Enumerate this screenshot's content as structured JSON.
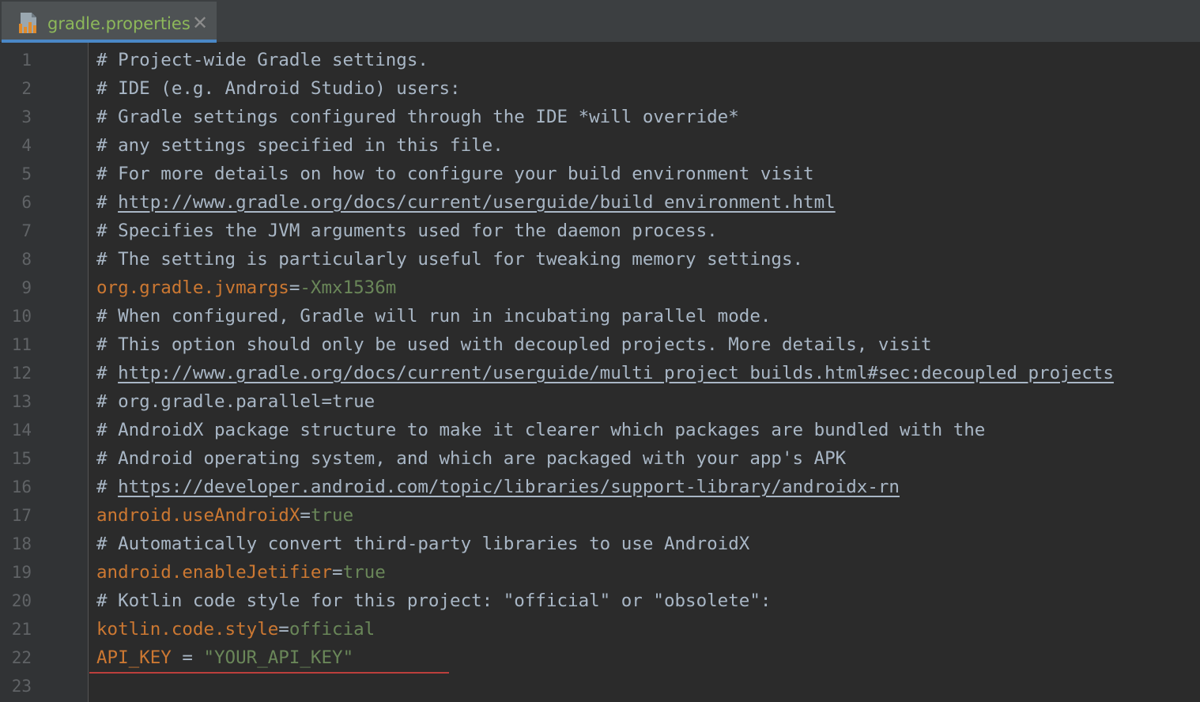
{
  "tab": {
    "label": "gradle.properties",
    "close_glyph": "✕",
    "icon": "gradle-properties-file-icon"
  },
  "colors": {
    "comment": "#a9b7c6",
    "key": "#cc7832",
    "value": "#6a8759",
    "error": "#bc3f3c",
    "tab_accent": "#4a88c7"
  },
  "lines": [
    {
      "n": "1",
      "parts": [
        {
          "t": "cm",
          "s": "# Project-wide Gradle settings."
        }
      ]
    },
    {
      "n": "2",
      "parts": [
        {
          "t": "cm",
          "s": "# IDE (e.g. Android Studio) users:"
        }
      ]
    },
    {
      "n": "3",
      "parts": [
        {
          "t": "cm",
          "s": "# Gradle settings configured through the IDE *will override*"
        }
      ]
    },
    {
      "n": "4",
      "parts": [
        {
          "t": "cm",
          "s": "# any settings specified in this file."
        }
      ]
    },
    {
      "n": "5",
      "parts": [
        {
          "t": "cm",
          "s": "# For more details on how to configure your build environment visit"
        }
      ]
    },
    {
      "n": "6",
      "parts": [
        {
          "t": "cm",
          "s": "# "
        },
        {
          "t": "lnk",
          "s": "http://www.gradle.org/docs/current/userguide/build_environment.html"
        }
      ]
    },
    {
      "n": "7",
      "parts": [
        {
          "t": "cm",
          "s": "# Specifies the JVM arguments used for the daemon process."
        }
      ]
    },
    {
      "n": "8",
      "parts": [
        {
          "t": "cm",
          "s": "# The setting is particularly useful for tweaking memory settings."
        }
      ]
    },
    {
      "n": "9",
      "parts": [
        {
          "t": "key",
          "s": "org.gradle.jvmargs"
        },
        {
          "t": "eq",
          "s": "="
        },
        {
          "t": "val",
          "s": "-Xmx1536m"
        }
      ]
    },
    {
      "n": "10",
      "parts": [
        {
          "t": "cm",
          "s": "# When configured, Gradle will run in incubating parallel mode."
        }
      ]
    },
    {
      "n": "11",
      "parts": [
        {
          "t": "cm",
          "s": "# This option should only be used with decoupled projects. More details, visit"
        }
      ]
    },
    {
      "n": "12",
      "parts": [
        {
          "t": "cm",
          "s": "# "
        },
        {
          "t": "lnk",
          "s": "http://www.gradle.org/docs/current/userguide/multi_project_builds.html#sec:decoupled_projects"
        }
      ]
    },
    {
      "n": "13",
      "parts": [
        {
          "t": "cm",
          "s": "# org.gradle.parallel=true"
        }
      ]
    },
    {
      "n": "14",
      "parts": [
        {
          "t": "cm",
          "s": "# AndroidX package structure to make it clearer which packages are bundled with the"
        }
      ]
    },
    {
      "n": "15",
      "parts": [
        {
          "t": "cm",
          "s": "# Android operating system, and which are packaged with your app's APK"
        }
      ]
    },
    {
      "n": "16",
      "parts": [
        {
          "t": "cm",
          "s": "# "
        },
        {
          "t": "lnk",
          "s": "https://developer.android.com/topic/libraries/support-library/androidx-rn"
        }
      ]
    },
    {
      "n": "17",
      "parts": [
        {
          "t": "key",
          "s": "android.useAndroidX"
        },
        {
          "t": "eq",
          "s": "="
        },
        {
          "t": "val",
          "s": "true"
        }
      ]
    },
    {
      "n": "18",
      "parts": [
        {
          "t": "cm",
          "s": "# Automatically convert third-party libraries to use AndroidX"
        }
      ]
    },
    {
      "n": "19",
      "parts": [
        {
          "t": "key",
          "s": "android.enableJetifier"
        },
        {
          "t": "eq",
          "s": "="
        },
        {
          "t": "val",
          "s": "true"
        }
      ]
    },
    {
      "n": "20",
      "parts": [
        {
          "t": "cm",
          "s": "# Kotlin code style for this project: \"official\" or \"obsolete\":"
        }
      ]
    },
    {
      "n": "21",
      "parts": [
        {
          "t": "key",
          "s": "kotlin.code.style"
        },
        {
          "t": "eq",
          "s": "="
        },
        {
          "t": "val",
          "s": "official"
        }
      ]
    },
    {
      "n": "22",
      "parts": [
        {
          "t": "key",
          "s": "API_KEY "
        },
        {
          "t": "eq",
          "s": "= "
        },
        {
          "t": "val",
          "s": "\"YOUR_API_KEY\""
        }
      ]
    },
    {
      "n": "23",
      "parts": []
    }
  ]
}
